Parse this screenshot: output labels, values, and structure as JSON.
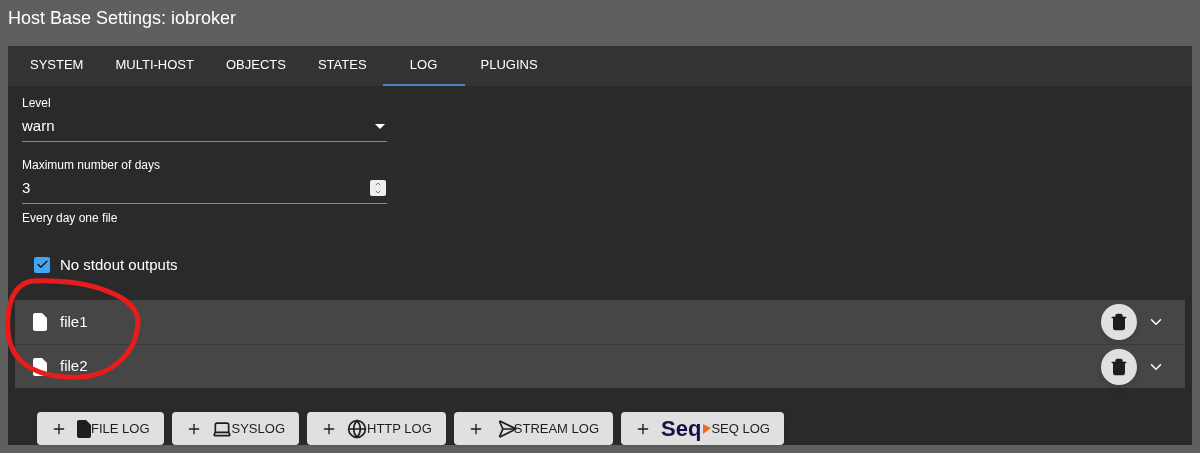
{
  "title": "Host Base Settings: iobroker",
  "tabs": [
    {
      "label": "SYSTEM",
      "selected": false
    },
    {
      "label": "MULTI-HOST",
      "selected": false
    },
    {
      "label": "OBJECTS",
      "selected": false
    },
    {
      "label": "STATES",
      "selected": false
    },
    {
      "label": "LOG",
      "selected": true
    },
    {
      "label": "PLUGINS",
      "selected": false
    }
  ],
  "level_field": {
    "label": "Level",
    "value": "warn"
  },
  "days_field": {
    "label": "Maximum number of days",
    "value": "3",
    "helper": "Every day one file"
  },
  "stdout_checkbox": {
    "label": "No stdout outputs",
    "checked": true
  },
  "files": [
    {
      "name": "file1"
    },
    {
      "name": "file2"
    }
  ],
  "add_buttons": [
    {
      "kind": "file",
      "label": "FILE LOG"
    },
    {
      "kind": "syslog",
      "label": "SYSLOG"
    },
    {
      "kind": "http",
      "label": "HTTP LOG"
    },
    {
      "kind": "stream",
      "label": "STREAM LOG"
    },
    {
      "kind": "seq",
      "logo": "Seq",
      "label": "SEQ LOG"
    }
  ]
}
